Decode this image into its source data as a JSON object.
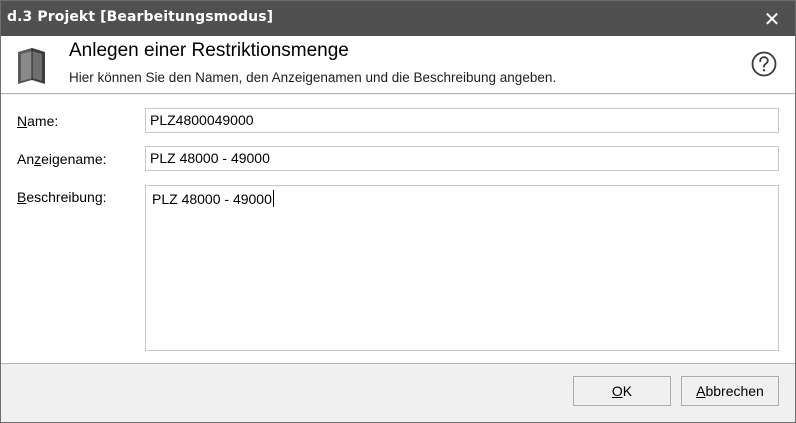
{
  "window": {
    "title": "d.3 Projekt [Bearbeitungsmodus]",
    "close_symbol": "✕"
  },
  "header": {
    "heading": "Anlegen einer Restriktionsmenge",
    "subheading": "Hier können Sie den Namen, den Anzeigenamen und die Beschreibung angeben.",
    "icon": "book-icon",
    "help_icon": "help-icon"
  },
  "form": {
    "name": {
      "label_mnemonic": "N",
      "label_rest": "ame:",
      "value": "PLZ4800049000"
    },
    "display_name": {
      "label_before": "An",
      "label_mnemonic": "z",
      "label_after": "eigename:",
      "value": "PLZ 48000 - 49000"
    },
    "description": {
      "label_mnemonic": "B",
      "label_rest": "eschreibung:",
      "value": "PLZ 48000 - 49000"
    }
  },
  "buttons": {
    "ok": {
      "label_mnemonic": "O",
      "label_rest": "K"
    },
    "cancel": {
      "label_mnemonic": "A",
      "label_rest": "bbrechen"
    }
  },
  "colors": {
    "titlebar": "#505050",
    "window_bg": "#f0f0f0",
    "content_bg": "#ffffff",
    "field_border": "#c8c8c8"
  }
}
